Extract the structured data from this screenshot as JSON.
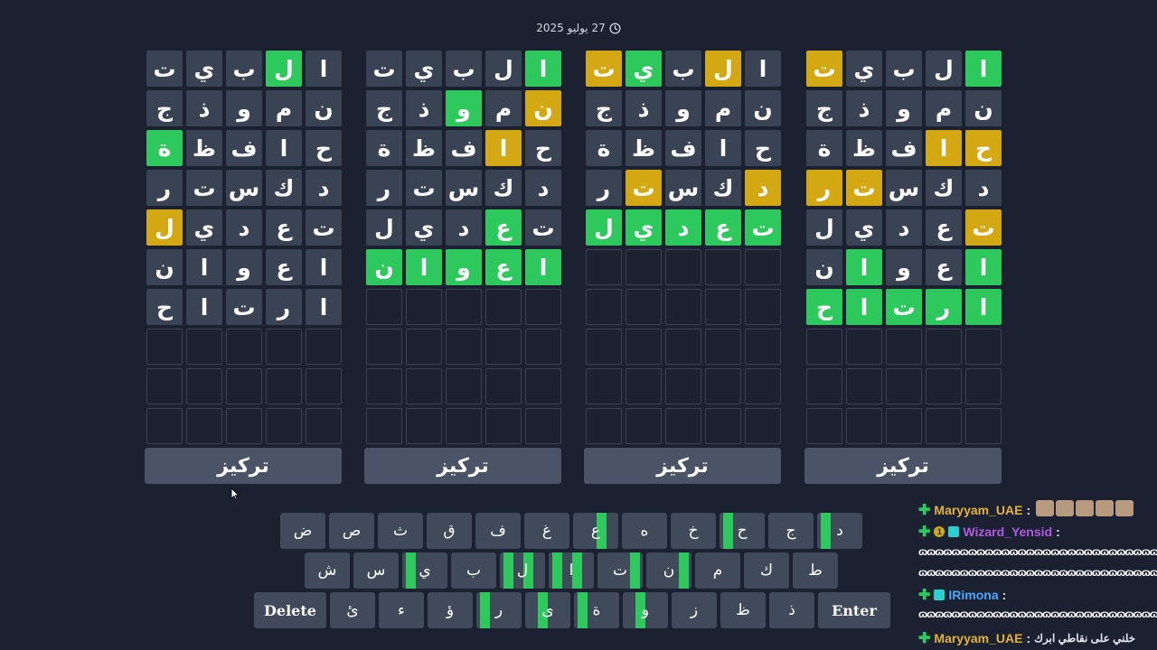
{
  "header": {
    "date": "27 يوليو 2025",
    "clock_icon": "clock-icon"
  },
  "colors": {
    "background": "#1b2130",
    "green": "#2ec95c",
    "yellow": "#d3a812",
    "tile": "#3a4354",
    "key": "#404a5b"
  },
  "boards": [
    {
      "focus_label": "تركيز",
      "rows": [
        [
          [
            "ا",
            "n"
          ],
          [
            "ل",
            "g"
          ],
          [
            "ب",
            "n"
          ],
          [
            "ي",
            "n"
          ],
          [
            "ت",
            "n"
          ]
        ],
        [
          [
            "ن",
            "n"
          ],
          [
            "م",
            "n"
          ],
          [
            "و",
            "n"
          ],
          [
            "ذ",
            "n"
          ],
          [
            "ج",
            "n"
          ]
        ],
        [
          [
            "ح",
            "n"
          ],
          [
            "ا",
            "n"
          ],
          [
            "ف",
            "n"
          ],
          [
            "ظ",
            "n"
          ],
          [
            "ة",
            "g"
          ]
        ],
        [
          [
            "د",
            "n"
          ],
          [
            "ك",
            "n"
          ],
          [
            "س",
            "n"
          ],
          [
            "ت",
            "n"
          ],
          [
            "ر",
            "n"
          ]
        ],
        [
          [
            "ت",
            "n"
          ],
          [
            "ع",
            "n"
          ],
          [
            "د",
            "n"
          ],
          [
            "ي",
            "n"
          ],
          [
            "ل",
            "y"
          ]
        ],
        [
          [
            "ا",
            "n"
          ],
          [
            "ع",
            "n"
          ],
          [
            "و",
            "n"
          ],
          [
            "ا",
            "n"
          ],
          [
            "ن",
            "n"
          ]
        ],
        [
          [
            "ا",
            "n"
          ],
          [
            "ر",
            "n"
          ],
          [
            "ت",
            "n"
          ],
          [
            "ا",
            "n"
          ],
          [
            "ح",
            "n"
          ]
        ]
      ]
    },
    {
      "focus_label": "تركيز",
      "rows": [
        [
          [
            "ا",
            "g"
          ],
          [
            "ل",
            "n"
          ],
          [
            "ب",
            "n"
          ],
          [
            "ي",
            "n"
          ],
          [
            "ت",
            "n"
          ]
        ],
        [
          [
            "ن",
            "y"
          ],
          [
            "م",
            "n"
          ],
          [
            "و",
            "g"
          ],
          [
            "ذ",
            "n"
          ],
          [
            "ج",
            "n"
          ]
        ],
        [
          [
            "ح",
            "n"
          ],
          [
            "ا",
            "y"
          ],
          [
            "ف",
            "n"
          ],
          [
            "ظ",
            "n"
          ],
          [
            "ة",
            "n"
          ]
        ],
        [
          [
            "د",
            "n"
          ],
          [
            "ك",
            "n"
          ],
          [
            "س",
            "n"
          ],
          [
            "ت",
            "n"
          ],
          [
            "ر",
            "n"
          ]
        ],
        [
          [
            "ت",
            "n"
          ],
          [
            "ع",
            "g"
          ],
          [
            "د",
            "n"
          ],
          [
            "ي",
            "n"
          ],
          [
            "ل",
            "n"
          ]
        ],
        [
          [
            "ا",
            "g"
          ],
          [
            "ع",
            "g"
          ],
          [
            "و",
            "g"
          ],
          [
            "ا",
            "g"
          ],
          [
            "ن",
            "g"
          ]
        ]
      ]
    },
    {
      "focus_label": "تركيز",
      "rows": [
        [
          [
            "ا",
            "n"
          ],
          [
            "ل",
            "y"
          ],
          [
            "ب",
            "n"
          ],
          [
            "ي",
            "g"
          ],
          [
            "ت",
            "y"
          ]
        ],
        [
          [
            "ن",
            "n"
          ],
          [
            "م",
            "n"
          ],
          [
            "و",
            "n"
          ],
          [
            "ذ",
            "n"
          ],
          [
            "ج",
            "n"
          ]
        ],
        [
          [
            "ح",
            "n"
          ],
          [
            "ا",
            "n"
          ],
          [
            "ف",
            "n"
          ],
          [
            "ظ",
            "n"
          ],
          [
            "ة",
            "n"
          ]
        ],
        [
          [
            "د",
            "y"
          ],
          [
            "ك",
            "n"
          ],
          [
            "س",
            "n"
          ],
          [
            "ت",
            "y"
          ],
          [
            "ر",
            "n"
          ]
        ],
        [
          [
            "ت",
            "g"
          ],
          [
            "ع",
            "g"
          ],
          [
            "د",
            "g"
          ],
          [
            "ي",
            "g"
          ],
          [
            "ل",
            "g"
          ]
        ]
      ]
    },
    {
      "focus_label": "تركيز",
      "rows": [
        [
          [
            "ا",
            "g"
          ],
          [
            "ل",
            "n"
          ],
          [
            "ب",
            "n"
          ],
          [
            "ي",
            "n"
          ],
          [
            "ت",
            "y"
          ]
        ],
        [
          [
            "ن",
            "n"
          ],
          [
            "م",
            "n"
          ],
          [
            "و",
            "n"
          ],
          [
            "ذ",
            "n"
          ],
          [
            "ج",
            "n"
          ]
        ],
        [
          [
            "ح",
            "y"
          ],
          [
            "ا",
            "y"
          ],
          [
            "ف",
            "n"
          ],
          [
            "ظ",
            "n"
          ],
          [
            "ة",
            "n"
          ]
        ],
        [
          [
            "د",
            "n"
          ],
          [
            "ك",
            "n"
          ],
          [
            "س",
            "n"
          ],
          [
            "ت",
            "y"
          ],
          [
            "ر",
            "y"
          ]
        ],
        [
          [
            "ت",
            "y"
          ],
          [
            "ع",
            "n"
          ],
          [
            "د",
            "n"
          ],
          [
            "ي",
            "n"
          ],
          [
            "ل",
            "n"
          ]
        ],
        [
          [
            "ا",
            "g"
          ],
          [
            "ع",
            "n"
          ],
          [
            "و",
            "n"
          ],
          [
            "ا",
            "g"
          ],
          [
            "ن",
            "n"
          ]
        ],
        [
          [
            "ا",
            "g"
          ],
          [
            "ر",
            "g"
          ],
          [
            "ت",
            "g"
          ],
          [
            "ا",
            "g"
          ],
          [
            "ح",
            "g"
          ]
        ]
      ]
    }
  ],
  "keyboard": {
    "row1": [
      {
        "k": "ض",
        "m": []
      },
      {
        "k": "ص",
        "m": []
      },
      {
        "k": "ث",
        "m": []
      },
      {
        "k": "ق",
        "m": []
      },
      {
        "k": "ف",
        "m": []
      },
      {
        "k": "غ",
        "m": []
      },
      {
        "k": "ع",
        "m": [
          2
        ]
      },
      {
        "k": "ه",
        "m": []
      },
      {
        "k": "خ",
        "m": []
      },
      {
        "k": "ح",
        "m": [
          0
        ]
      },
      {
        "k": "ج",
        "m": []
      },
      {
        "k": "د",
        "m": [
          0
        ]
      }
    ],
    "row2": [
      {
        "k": "ش",
        "m": []
      },
      {
        "k": "س",
        "m": []
      },
      {
        "k": "ي",
        "m": [
          0
        ]
      },
      {
        "k": "ب",
        "m": []
      },
      {
        "k": "ل",
        "m": [
          0,
          2
        ]
      },
      {
        "k": "ا",
        "m": [
          0,
          2
        ]
      },
      {
        "k": "ت",
        "m": [
          3
        ]
      },
      {
        "k": "ن",
        "m": [
          3
        ]
      },
      {
        "k": "م",
        "m": []
      },
      {
        "k": "ك",
        "m": []
      },
      {
        "k": "ط",
        "m": []
      }
    ],
    "row3": [
      {
        "k": "Delete",
        "m": [],
        "wide": true
      },
      {
        "k": "ئ",
        "m": []
      },
      {
        "k": "ء",
        "m": []
      },
      {
        "k": "ؤ",
        "m": []
      },
      {
        "k": "ر",
        "m": [
          0
        ]
      },
      {
        "k": "ى",
        "m": [
          1
        ]
      },
      {
        "k": "ة",
        "m": [
          0
        ]
      },
      {
        "k": "و",
        "m": [
          1
        ]
      },
      {
        "k": "ز",
        "m": []
      },
      {
        "k": "ظ",
        "m": []
      },
      {
        "k": "ذ",
        "m": []
      },
      {
        "k": "Enter",
        "m": [],
        "wide": true
      }
    ]
  },
  "chat": {
    "messages": [
      {
        "user": "Maryyam_UAE",
        "color": "#e3b23c",
        "sep": ":",
        "text": "",
        "emotes": 5
      },
      {
        "user": "Wizard_Yensid",
        "color": "#b05ae0",
        "sep": ":",
        "badges": true,
        "spam1": "ɷɷɷɷɷɷɷɷɷɷɷɷɷɷɷɷɷɷɷɷɷɷɷɷɷɷɷɷɷɷɷɷɷɷɷɷɷɷɷɷɷɷ",
        "spam2": "ɷɷɷɷɷɷɷɷɷɷɷɷɷɷɷɷɷɷɷɷɷɷɷɷɷɷɷɷɷɷɷɷɷɷ"
      },
      {
        "user": "IRimona",
        "color": "#4aa8ff",
        "sep": ":",
        "badges2": true,
        "spam1": "ɷɷɷɷɷɷɷɷɷɷɷɷɷɷɷɷɷɷɷɷɷɷɷɷɷɷɷɷɷɷɷɷɷɷɷɷɷɷɷɷ"
      },
      {
        "user": "Maryyam_UAE",
        "color": "#e3b23c",
        "sep": ":",
        "text": "خلني على نقاطي ابرك"
      }
    ]
  }
}
